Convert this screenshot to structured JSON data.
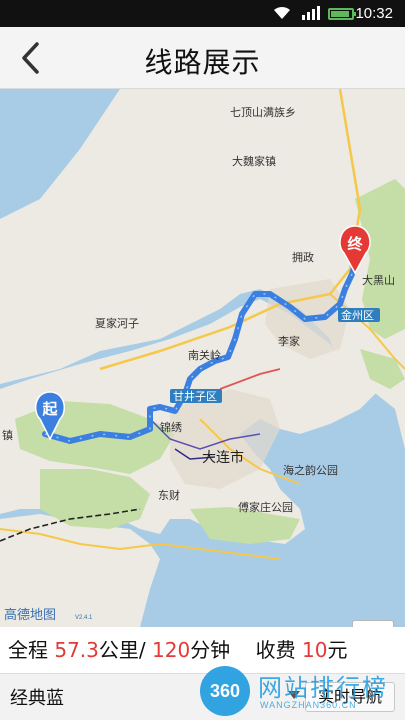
{
  "status_bar": {
    "time": "10:32"
  },
  "header": {
    "title": "线路展示"
  },
  "map": {
    "labels": {
      "qidingshan": "七顶山满族乡",
      "daweijia": "大魏家镇",
      "yongzheng": "拥政",
      "dahei": "大黑山",
      "xiajiahezi": "夏家河子",
      "jinzhou": "金州区",
      "lijia": "李家",
      "nanguanling": "南关岭",
      "ganjingzi": "甘井子区",
      "jinxiu": "锦绣",
      "dalian": "大连市",
      "haizhiyun": "海之韵公园",
      "dongcai": "东财",
      "fujiazhuang": "傅家庄公园",
      "zhen": "镇",
      "gaode": "高德地图",
      "version": "V2.4.1"
    },
    "start_marker": "起",
    "end_marker": "终",
    "zoom_in": "+",
    "zoom_out": "−",
    "route_color": "#3b7fe0"
  },
  "info": {
    "total_label": "全程",
    "distance": "57.3",
    "distance_unit": "公里/",
    "duration": "120",
    "duration_unit": "分钟",
    "fee_label": "收费",
    "fee": "10",
    "fee_unit": "元"
  },
  "bottom": {
    "scheme": "经典蓝",
    "nav_button": "实时导航"
  },
  "watermark": {
    "logo": "360",
    "text": "网站排行榜",
    "sub": "WANGZHAN360.CN"
  }
}
